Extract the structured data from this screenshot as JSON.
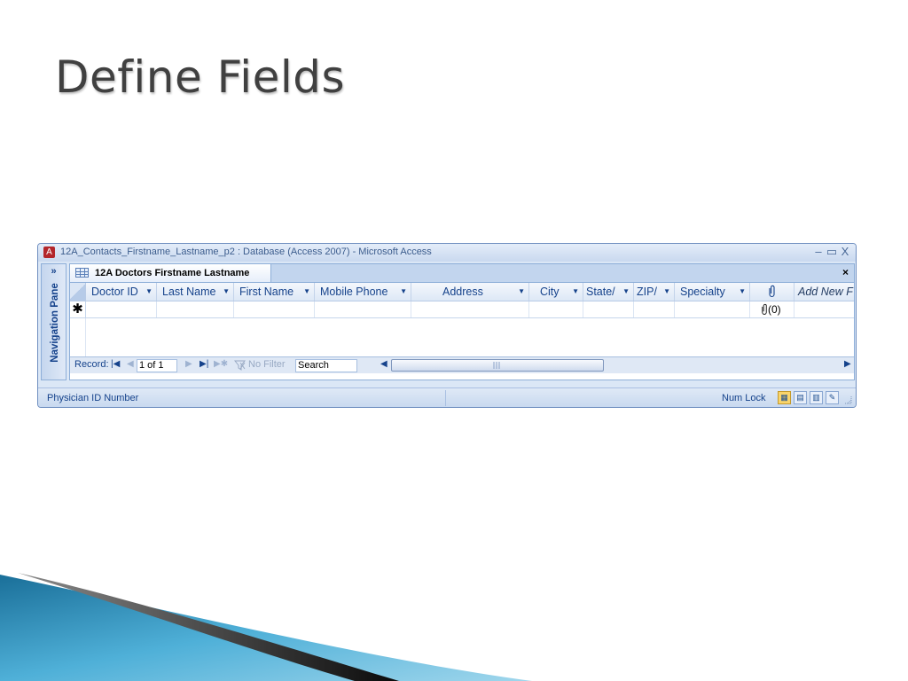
{
  "slide": {
    "title": "Define Fields"
  },
  "window": {
    "title": "12A_Contacts_Firstname_Lastname_p2 : Database (Access 2007) - Microsoft Access",
    "controls": {
      "minimize": "–",
      "maximize": "▭",
      "close": "X"
    }
  },
  "nav_pane": {
    "toggle": "»",
    "label": "Navigation Pane"
  },
  "tab": {
    "label": "12A Doctors Firstname Lastname",
    "close": "×"
  },
  "columns": [
    {
      "label": "Doctor ID",
      "dropdown": "▼"
    },
    {
      "label": "Last Name",
      "dropdown": "▼"
    },
    {
      "label": "First Name",
      "dropdown": "▼"
    },
    {
      "label": "Mobile Phone",
      "dropdown": "▼"
    },
    {
      "label": "Address",
      "dropdown": "▼"
    },
    {
      "label": "City",
      "dropdown": "▼"
    },
    {
      "label": "State/",
      "dropdown": "▼"
    },
    {
      "label": "ZIP/",
      "dropdown": "▼"
    },
    {
      "label": "Specialty",
      "dropdown": "▼"
    },
    {
      "label": "",
      "icon": "paperclip-icon"
    },
    {
      "label": "Add New F"
    }
  ],
  "new_record_row": {
    "marker": "✱",
    "attachment_count": "(0)"
  },
  "record_nav": {
    "label": "Record:",
    "first": "|◀",
    "prev": "◀",
    "current": "1 of 1",
    "next": "▶",
    "last": "▶|",
    "new": "▶✱",
    "filter": "No Filter",
    "search": "Search",
    "scroll_left": "◀",
    "scroll_right": "▶"
  },
  "status": {
    "text": "Physician ID Number",
    "num_lock": "Num Lock"
  },
  "colors": {
    "accent": "#15428b",
    "title_text": "#404040",
    "window_frame": "#6f8fc0",
    "swoosh_light": "#4fb0d8",
    "swoosh_dark": "#0a0a0a"
  }
}
